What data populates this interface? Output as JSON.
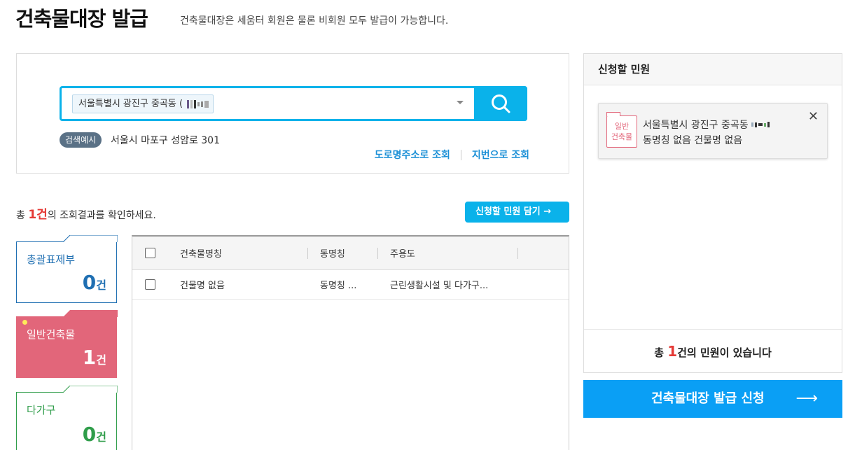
{
  "header": {
    "title": "건축물대장 발급",
    "description": "건축물대장은 세움터 회원은 물론 비회원 모두 발급이 가능합니다."
  },
  "search": {
    "chip_text": "서울특별시 광진구 중곡동 (",
    "example_badge": "검색예시",
    "example_text": "서울시 마포구 성암로 301",
    "road_lookup": "도로명주소로 조회",
    "lot_lookup": "지번으로 조회"
  },
  "results": {
    "prefix": "총 ",
    "count": "1건",
    "suffix": "의 조회결과를 확인하세요.",
    "add_button": "신청할 민원 담기 →"
  },
  "categories": [
    {
      "label": "총괄표제부",
      "count": "0",
      "unit": "건"
    },
    {
      "label": "일반건축물",
      "count": "1",
      "unit": "건"
    },
    {
      "label": "다가구",
      "count": "0",
      "unit": "건"
    }
  ],
  "table": {
    "headers": [
      "건축물명칭",
      "동명칭",
      "주용도"
    ],
    "rows": [
      {
        "name": "건물명 없음",
        "dong": "동명칭 ...",
        "use": "근린생활시설 및 다가구..."
      }
    ]
  },
  "side": {
    "title": "신청할 민원",
    "card": {
      "icon_line1": "일반",
      "icon_line2": "건축물",
      "address": "서울특별시 광진구 중곡동",
      "detail": "동명칭 없음 건물명 없음",
      "close": "✕"
    },
    "footer_prefix": "총 ",
    "footer_count": "1",
    "footer_suffix": "건의 민원이 있습니다"
  },
  "issue_button": {
    "label": "건축물대장 발급 신청",
    "arrow": "⟶"
  },
  "colors": {
    "accent": "#0ab2ea",
    "issue_button": "#0a9ff5",
    "highlight_red": "#e53935",
    "general_pink": "#e2667a",
    "total_blue": "#1f6fb2",
    "multi_green": "#2f9d4a"
  }
}
